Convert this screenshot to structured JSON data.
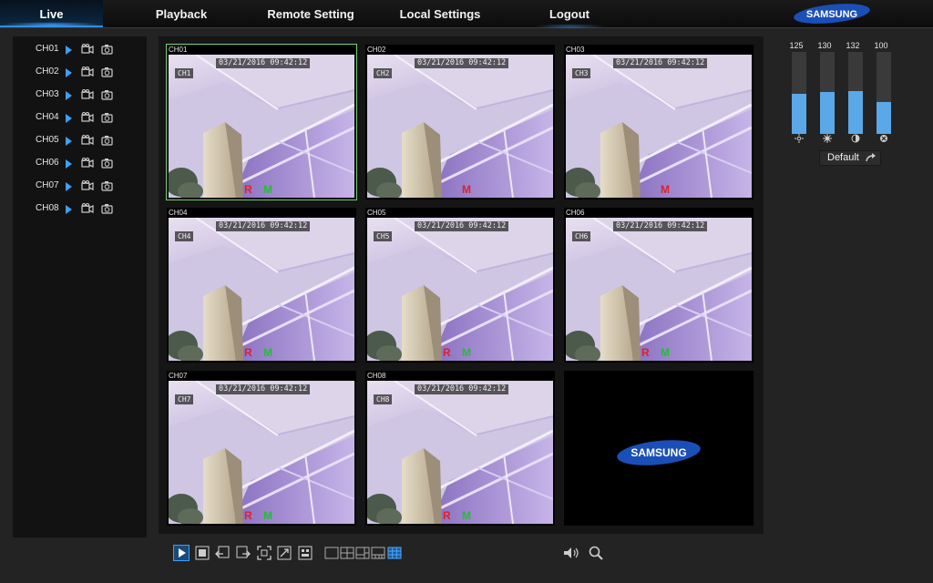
{
  "nav": {
    "items": [
      {
        "label": "Live",
        "active": true
      },
      {
        "label": "Playback",
        "active": false
      },
      {
        "label": "Remote Setting",
        "active": false
      },
      {
        "label": "Local Settings",
        "active": false
      },
      {
        "label": "Logout",
        "active": false
      }
    ],
    "brand": "SAMSUNG"
  },
  "channels": [
    {
      "label": "CH01"
    },
    {
      "label": "CH02"
    },
    {
      "label": "CH03"
    },
    {
      "label": "CH04"
    },
    {
      "label": "CH05"
    },
    {
      "label": "CH06"
    },
    {
      "label": "CH07"
    },
    {
      "label": "CH08"
    }
  ],
  "grid": {
    "cells": [
      {
        "title": "CH01",
        "timestamp": "03/21/2016 09:42:12",
        "osd": "CH1",
        "rec": "R",
        "motion": "M",
        "selected": true
      },
      {
        "title": "CH02",
        "timestamp": "03/21/2016 09:42:12",
        "osd": "CH2",
        "rec": "",
        "motion": "M",
        "selected": false
      },
      {
        "title": "CH03",
        "timestamp": "03/21/2016 09:42:12",
        "osd": "CH3",
        "rec": "",
        "motion": "M",
        "selected": false
      },
      {
        "title": "CH04",
        "timestamp": "03/21/2016 09:42:12",
        "osd": "CH4",
        "rec": "R",
        "motion": "M",
        "selected": false
      },
      {
        "title": "CH05",
        "timestamp": "03/21/2016 09:42:12",
        "osd": "CH5",
        "rec": "R",
        "motion": "M",
        "selected": false
      },
      {
        "title": "CH06",
        "timestamp": "03/21/2016 09:42:12",
        "osd": "CH6",
        "rec": "R",
        "motion": "M",
        "selected": false
      },
      {
        "title": "CH07",
        "timestamp": "03/21/2016 09:42:12",
        "osd": "CH7",
        "rec": "R",
        "motion": "M",
        "selected": false
      },
      {
        "title": "CH08",
        "timestamp": "03/21/2016 09:42:12",
        "osd": "CH8",
        "rec": "R",
        "motion": "M",
        "selected": false
      }
    ],
    "empty_cell_logo": "SAMSUNG"
  },
  "image_adjust": {
    "sliders": [
      {
        "name": "brightness",
        "value": "125",
        "level": 0.49,
        "icon": "brightness-icon"
      },
      {
        "name": "saturation",
        "value": "130",
        "level": 0.51,
        "icon": "saturation-icon"
      },
      {
        "name": "contrast",
        "value": "132",
        "level": 0.52,
        "icon": "contrast-icon"
      },
      {
        "name": "hue",
        "value": "100",
        "level": 0.39,
        "icon": "hue-icon"
      }
    ],
    "default_label": "Default"
  },
  "toolbar": {
    "buttons": [
      "play-all-icon",
      "stop-all-icon",
      "previous-icon",
      "next-icon",
      "fullscreen-icon",
      "exit-fullscreen-icon",
      "record-all-icon"
    ],
    "layouts": [
      "layout-1-icon",
      "layout-4-icon",
      "layout-6-icon",
      "layout-8-icon",
      "layout-9-icon"
    ],
    "active_layout": 4,
    "audio": "volume-icon",
    "zoom": "zoom-icon"
  },
  "colors": {
    "accent": "#3aa0ff",
    "rec": "#e0202a",
    "motion": "#20c030",
    "slider": "#5aa8e8",
    "selected_border": "#7cd17a"
  }
}
